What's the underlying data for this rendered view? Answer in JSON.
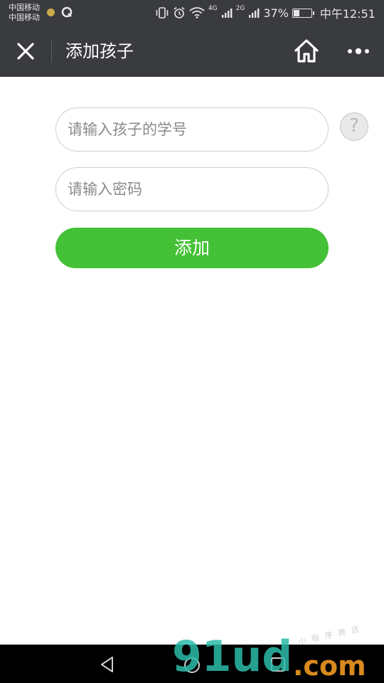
{
  "status_bar": {
    "carrier_1": "中国移动",
    "carrier_2": "中国移动",
    "network_1": "4G",
    "network_2": "2G",
    "battery_percent": "37%",
    "battery_level": 0.37,
    "time": "中午12:51"
  },
  "nav": {
    "title": "添加孩子"
  },
  "form": {
    "student_id_placeholder": "请输入孩子的学号",
    "password_placeholder": "请输入密码",
    "help_label": "?",
    "submit_label": "添加"
  },
  "watermark": {
    "logo": "91ud",
    "suffix": ".com",
    "slogan": "小程序商店"
  },
  "colors": {
    "bar_bg": "#3a3b3f",
    "accent_green": "#44c136",
    "field_border": "#cfcfcf"
  }
}
